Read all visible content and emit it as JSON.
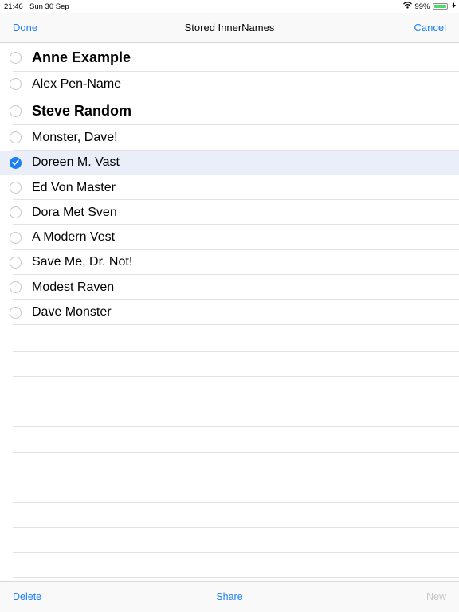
{
  "status": {
    "time": "21:46",
    "date": "Sun 30 Sep",
    "battery_percent": "99%",
    "battery_level": 0.99
  },
  "nav": {
    "left_button": "Done",
    "title": "Stored InnerNames",
    "right_button": "Cancel"
  },
  "names": [
    {
      "label": "Anne Example",
      "bold": true,
      "checked": false
    },
    {
      "label": "Alex Pen-Name",
      "bold": false,
      "checked": false
    },
    {
      "label": "Steve Random",
      "bold": true,
      "checked": false
    },
    {
      "label": "Monster, Dave!",
      "bold": false,
      "checked": false
    },
    {
      "label": "Doreen M. Vast",
      "bold": false,
      "checked": true
    },
    {
      "label": "Ed Von Master",
      "bold": false,
      "checked": false
    },
    {
      "label": "Dora Met Sven",
      "bold": false,
      "checked": false
    },
    {
      "label": "A Modern Vest",
      "bold": false,
      "checked": false
    },
    {
      "label": "Save Me, Dr. Not!",
      "bold": false,
      "checked": false
    },
    {
      "label": "Modest Raven",
      "bold": false,
      "checked": false
    },
    {
      "label": "Dave Monster",
      "bold": false,
      "checked": false
    }
  ],
  "toolbar": {
    "delete_label": "Delete",
    "share_label": "Share",
    "new_label": "New",
    "new_enabled": false
  },
  "colors": {
    "accent": "#1a7ff5",
    "selected_row": "#e9eef8",
    "disabled": "#c7c7cc"
  }
}
